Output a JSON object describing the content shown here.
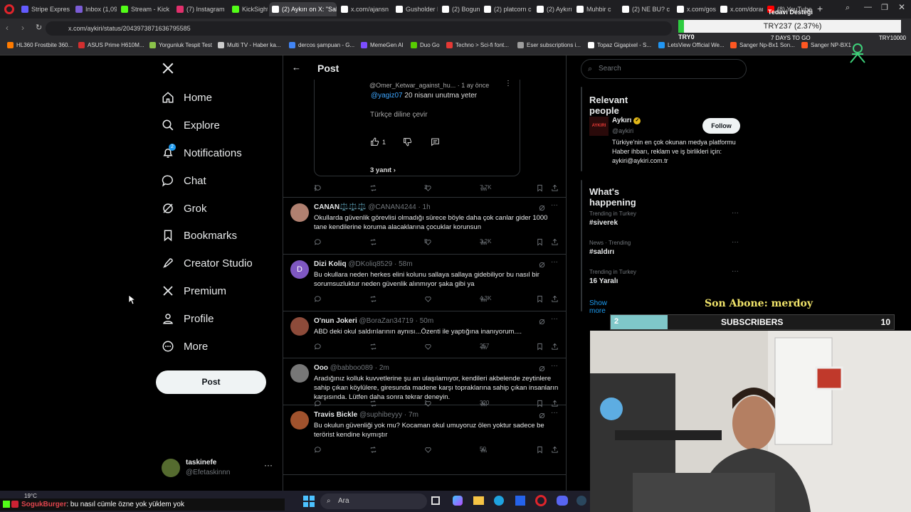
{
  "browser": {
    "tabs": [
      {
        "label": "Stripe Expres",
        "color": "#635bff"
      },
      {
        "label": "Inbox (1,093)",
        "color": "#7b5cd6"
      },
      {
        "label": "Stream - Kick",
        "color": "#53fc18"
      },
      {
        "label": "(7) Instagram",
        "color": "#e1306c"
      },
      {
        "label": "KickSight Lin",
        "color": "#53fc18"
      },
      {
        "label": "(2) Aykırı on X: \"Saldı",
        "color": "#ffffff"
      },
      {
        "label": "x.com/ajansn",
        "color": "#ffffff"
      },
      {
        "label": "Gusholder H",
        "color": "#ffffff"
      },
      {
        "label": "(2) Boguna T",
        "color": "#ffffff"
      },
      {
        "label": "(2) platcorn c",
        "color": "#ffffff"
      },
      {
        "label": "(2) Aykırı on",
        "color": "#ffffff"
      },
      {
        "label": "Muhbir c",
        "color": "#ffffff"
      },
      {
        "label": "(2) NE BU? c",
        "color": "#ffffff"
      },
      {
        "label": "x.com/gossip",
        "color": "#ffffff"
      },
      {
        "label": "x.com/doran",
        "color": "#ffffff"
      },
      {
        "label": "(8) YouTube",
        "color": "#ff0000"
      }
    ],
    "url": "x.com/aykiri/status/2043973871636795585",
    "bookmarks": [
      {
        "label": "HL360 Frostbite 360...",
        "color": "#ff7b00"
      },
      {
        "label": "ASUS Prime H610M...",
        "color": "#d32f2f"
      },
      {
        "label": "Yorgunluk Tespit Test",
        "color": "#8bc34a"
      },
      {
        "label": "Multi TV - Haber ka...",
        "color": "#cccccc"
      },
      {
        "label": "dercos şampuan - G...",
        "color": "#4285f4"
      },
      {
        "label": "MemeGen AI",
        "color": "#7c4dff"
      },
      {
        "label": "Duo Go",
        "color": "#58cc02"
      },
      {
        "label": "Techno > Sci-fi font...",
        "color": "#e53935"
      },
      {
        "label": "Eser subscriptions i...",
        "color": "#9e9e9e"
      },
      {
        "label": "Topaz Gigapixel - S...",
        "color": "#ffffff"
      },
      {
        "label": "LetsView Official We...",
        "color": "#2196f3"
      },
      {
        "label": "Sanger Np-Bx1 Son...",
        "color": "#ff5722"
      },
      {
        "label": "Sanger NP-BX1",
        "color": "#ff5722"
      }
    ]
  },
  "ticker": {
    "label": "Tedavi Desteği",
    "value": "TRY237 (2.37%)",
    "left": "TRY0",
    "center": "7 DAYS TO GO",
    "right": "TRY10000"
  },
  "sidebar": {
    "items": [
      {
        "label": "Home",
        "icon": "home-icon"
      },
      {
        "label": "Explore",
        "icon": "search-icon"
      },
      {
        "label": "Notifications",
        "icon": "bell-icon",
        "badge": "2"
      },
      {
        "label": "Chat",
        "icon": "chat-icon"
      },
      {
        "label": "Grok",
        "icon": "grok-icon"
      },
      {
        "label": "Bookmarks",
        "icon": "bookmark-icon"
      },
      {
        "label": "Creator Studio",
        "icon": "rocket-icon"
      },
      {
        "label": "Premium",
        "icon": "x-logo-icon"
      },
      {
        "label": "Profile",
        "icon": "person-icon"
      },
      {
        "label": "More",
        "icon": "more-icon"
      }
    ],
    "post_label": "Post",
    "user": {
      "name": "taskinefe",
      "handle": "@Efetaskinnn"
    }
  },
  "header": {
    "title": "Post"
  },
  "quoted": {
    "handle": "@Omer_Ketwar_against_hu...",
    "time": "· 1 ay önce",
    "mention": "@yagiz07",
    "text": " 20 nisanı unutma yeter",
    "translate": "Türkçe diline çevir",
    "likes": "1",
    "replies": "3 yanıt"
  },
  "top_actions": {
    "replies": "1",
    "likes": "3",
    "views": "7.7K"
  },
  "tweets": [
    {
      "name": "CANAN⚖️⚖️⚖️",
      "handle": "@CANAN4244",
      "time": "· 1h",
      "text": "Okullarda güvenlik görevlisi olmadığı sürece böyle daha çok canlar gider 1000 tane kendilerine koruma alacaklarına çocuklar korunsun",
      "replies": "",
      "likes": "5",
      "views": "3.2K",
      "avatar": "#b08070"
    },
    {
      "name": "Dizi Koliq",
      "handle": "@DKoliq8529",
      "time": "· 58m",
      "text": "Bu okullara neden herkes elini kolunu sallaya sallaya gidebiliyor bu nasıl bir sorumsuzluktur neden güvenlik alınmıyor şaka gibi ya",
      "replies": "",
      "likes": "",
      "views": "4.3K",
      "avatar": "#7e57c2",
      "initial": "D"
    },
    {
      "name": "O'nun Jokeri",
      "handle": "@BoraZan34719",
      "time": "· 50m",
      "text": "ABD deki okul saldırılarının aynısı...Özenti ile yaptığına inanıyorum....",
      "replies": "",
      "likes": "",
      "views": "257",
      "avatar": "#8d4b3a"
    },
    {
      "name": "Ooo",
      "handle": "@babboo089",
      "time": "· 2m",
      "text": "Aradığınız kolluk kuvvetlerine şu an ulaşılamıyor, kendileri akbelende zeytinlere sahip çıkan köylülere, giresunda madene karşı topraklarına sahip çıkan insanların karşısında. Lütfen daha sonra tekrar deneyin.",
      "replies": "",
      "likes": "1",
      "views": "320",
      "avatar": "#777777"
    },
    {
      "name": "Travis Bickle",
      "handle": "@suphibeyyy",
      "time": "· 7m",
      "text": "Bu okulun güvenliği yok mu? Kocaman okul umuyoruz ölen yoktur sadece be terörist kendine kıymıştır",
      "replies": "",
      "likes": "",
      "views": "50",
      "avatar": "#a0522d"
    }
  ],
  "right": {
    "search_placeholder": "Search",
    "relevant_title": "Relevant people",
    "person": {
      "name": "Aykırı",
      "handle": "@aykiri",
      "bio": "Türkiye'nin en çok okunan medya platformu Haber ihbarı, reklam ve iş birlikleri için: aykiri@aykiri.com.tr",
      "follow": "Follow",
      "logo": "AYKIRI"
    },
    "happening_title": "What's happening",
    "trends": [
      {
        "context": "Trending in Turkey",
        "tag": "#siverek"
      },
      {
        "context": "News · Trending",
        "tag": "#saldırı"
      },
      {
        "context": "Trending in Turkey",
        "tag": "16 Yaralı"
      }
    ],
    "show_more": "Show more"
  },
  "overlay": {
    "last_sub": "Son Abone: merdoy",
    "subs_label": "SUBSCRIBERS",
    "subs_current": "2",
    "subs_goal": "10",
    "subs_progress": 0.2,
    "chat_user": "SogukBurger",
    "chat_message": ": bu nasıl cümle özne yok yüklem yok"
  },
  "taskbar": {
    "weather": "19°C",
    "search": "Ara"
  }
}
